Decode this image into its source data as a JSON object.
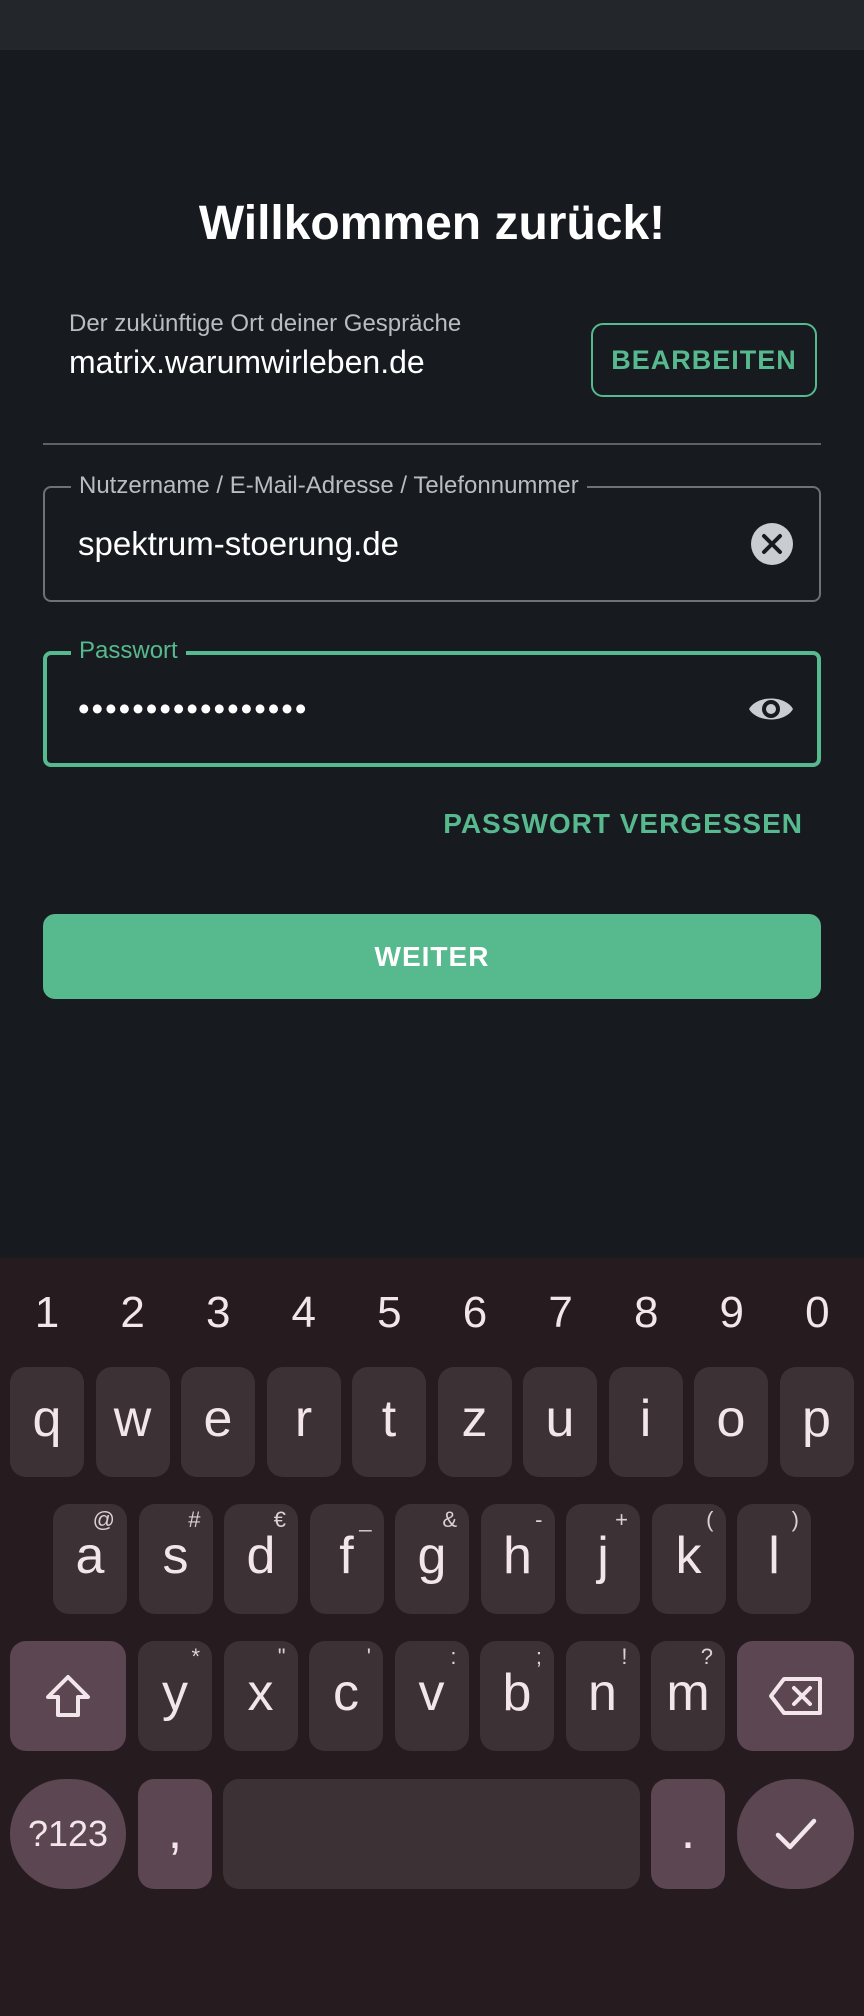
{
  "login": {
    "title": "Willkommen zurück!",
    "server_subtitle": "Der zukünftige Ort deiner Gespräche",
    "server_name": "matrix.warumwirleben.de",
    "edit_button": "BEARBEITEN",
    "username_label": "Nutzername / E-Mail-Adresse / Telefonnummer",
    "username_value": "spektrum-stoerung.de",
    "password_label": "Passwort",
    "password_value": "•••••••••••••••••",
    "forgot_password": "PASSWORT VERGESSEN",
    "continue_button": "WEITER"
  },
  "colors": {
    "background": "#171a1f",
    "accent": "#57b98e",
    "keyboard_bg": "#261c20",
    "key_bg": "#3c3134",
    "func_key_bg": "#5b4651"
  },
  "keyboard": {
    "numbers": [
      "1",
      "2",
      "3",
      "4",
      "5",
      "6",
      "7",
      "8",
      "9",
      "0"
    ],
    "row1": [
      "q",
      "w",
      "e",
      "r",
      "t",
      "z",
      "u",
      "i",
      "o",
      "p"
    ],
    "row2": [
      {
        "key": "a",
        "hint": "@"
      },
      {
        "key": "s",
        "hint": "#"
      },
      {
        "key": "d",
        "hint": "€"
      },
      {
        "key": "f",
        "hint": "_"
      },
      {
        "key": "g",
        "hint": "&"
      },
      {
        "key": "h",
        "hint": "-"
      },
      {
        "key": "j",
        "hint": "+"
      },
      {
        "key": "k",
        "hint": "("
      },
      {
        "key": "l",
        "hint": ")"
      }
    ],
    "row3": [
      {
        "key": "y",
        "hint": "*"
      },
      {
        "key": "x",
        "hint": "\""
      },
      {
        "key": "c",
        "hint": "'"
      },
      {
        "key": "v",
        "hint": ":"
      },
      {
        "key": "b",
        "hint": ";"
      },
      {
        "key": "n",
        "hint": "!"
      },
      {
        "key": "m",
        "hint": "?"
      }
    ],
    "symbols_key": "?123",
    "comma_key": ",",
    "period_key": ".",
    "shift_icon": "shift-icon",
    "backspace_icon": "backspace-icon",
    "enter_icon": "checkmark-icon"
  }
}
